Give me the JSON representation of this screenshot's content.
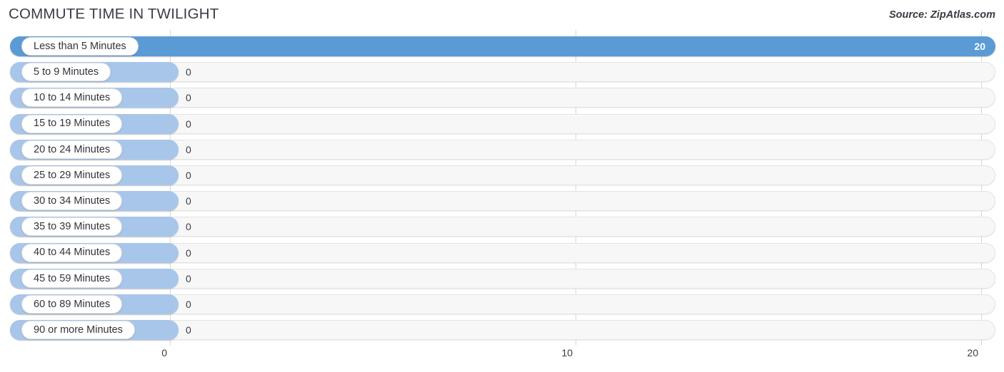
{
  "header": {
    "title": "COMMUTE TIME IN TWILIGHT",
    "source": "Source: ZipAtlas.com"
  },
  "colors": {
    "bar_full": "#5b9bd5",
    "bar_empty": "#a8c6ea",
    "track": "#f7f7f7",
    "gridline": "#d9d9d9",
    "text": "#33333c"
  },
  "axis": {
    "ticks": [
      {
        "label": "0",
        "value": 0
      },
      {
        "label": "10",
        "value": 10
      },
      {
        "label": "20",
        "value": 20
      }
    ]
  },
  "chart_data": {
    "type": "bar",
    "orientation": "horizontal",
    "title": "COMMUTE TIME IN TWILIGHT",
    "source": "Source: ZipAtlas.com",
    "xlabel": "",
    "ylabel": "",
    "xlim": [
      0,
      20
    ],
    "grid": true,
    "legend": "none",
    "categories": [
      "Less than 5 Minutes",
      "5 to 9 Minutes",
      "10 to 14 Minutes",
      "15 to 19 Minutes",
      "20 to 24 Minutes",
      "25 to 29 Minutes",
      "30 to 34 Minutes",
      "35 to 39 Minutes",
      "40 to 44 Minutes",
      "45 to 59 Minutes",
      "60 to 89 Minutes",
      "90 or more Minutes"
    ],
    "values": [
      20,
      0,
      0,
      0,
      0,
      0,
      0,
      0,
      0,
      0,
      0,
      0
    ],
    "value_labels": [
      "20",
      "0",
      "0",
      "0",
      "0",
      "0",
      "0",
      "0",
      "0",
      "0",
      "0",
      "0"
    ],
    "xtick_labels": [
      "0",
      "10",
      "20"
    ],
    "xtick_values": [
      0,
      10,
      20
    ]
  }
}
